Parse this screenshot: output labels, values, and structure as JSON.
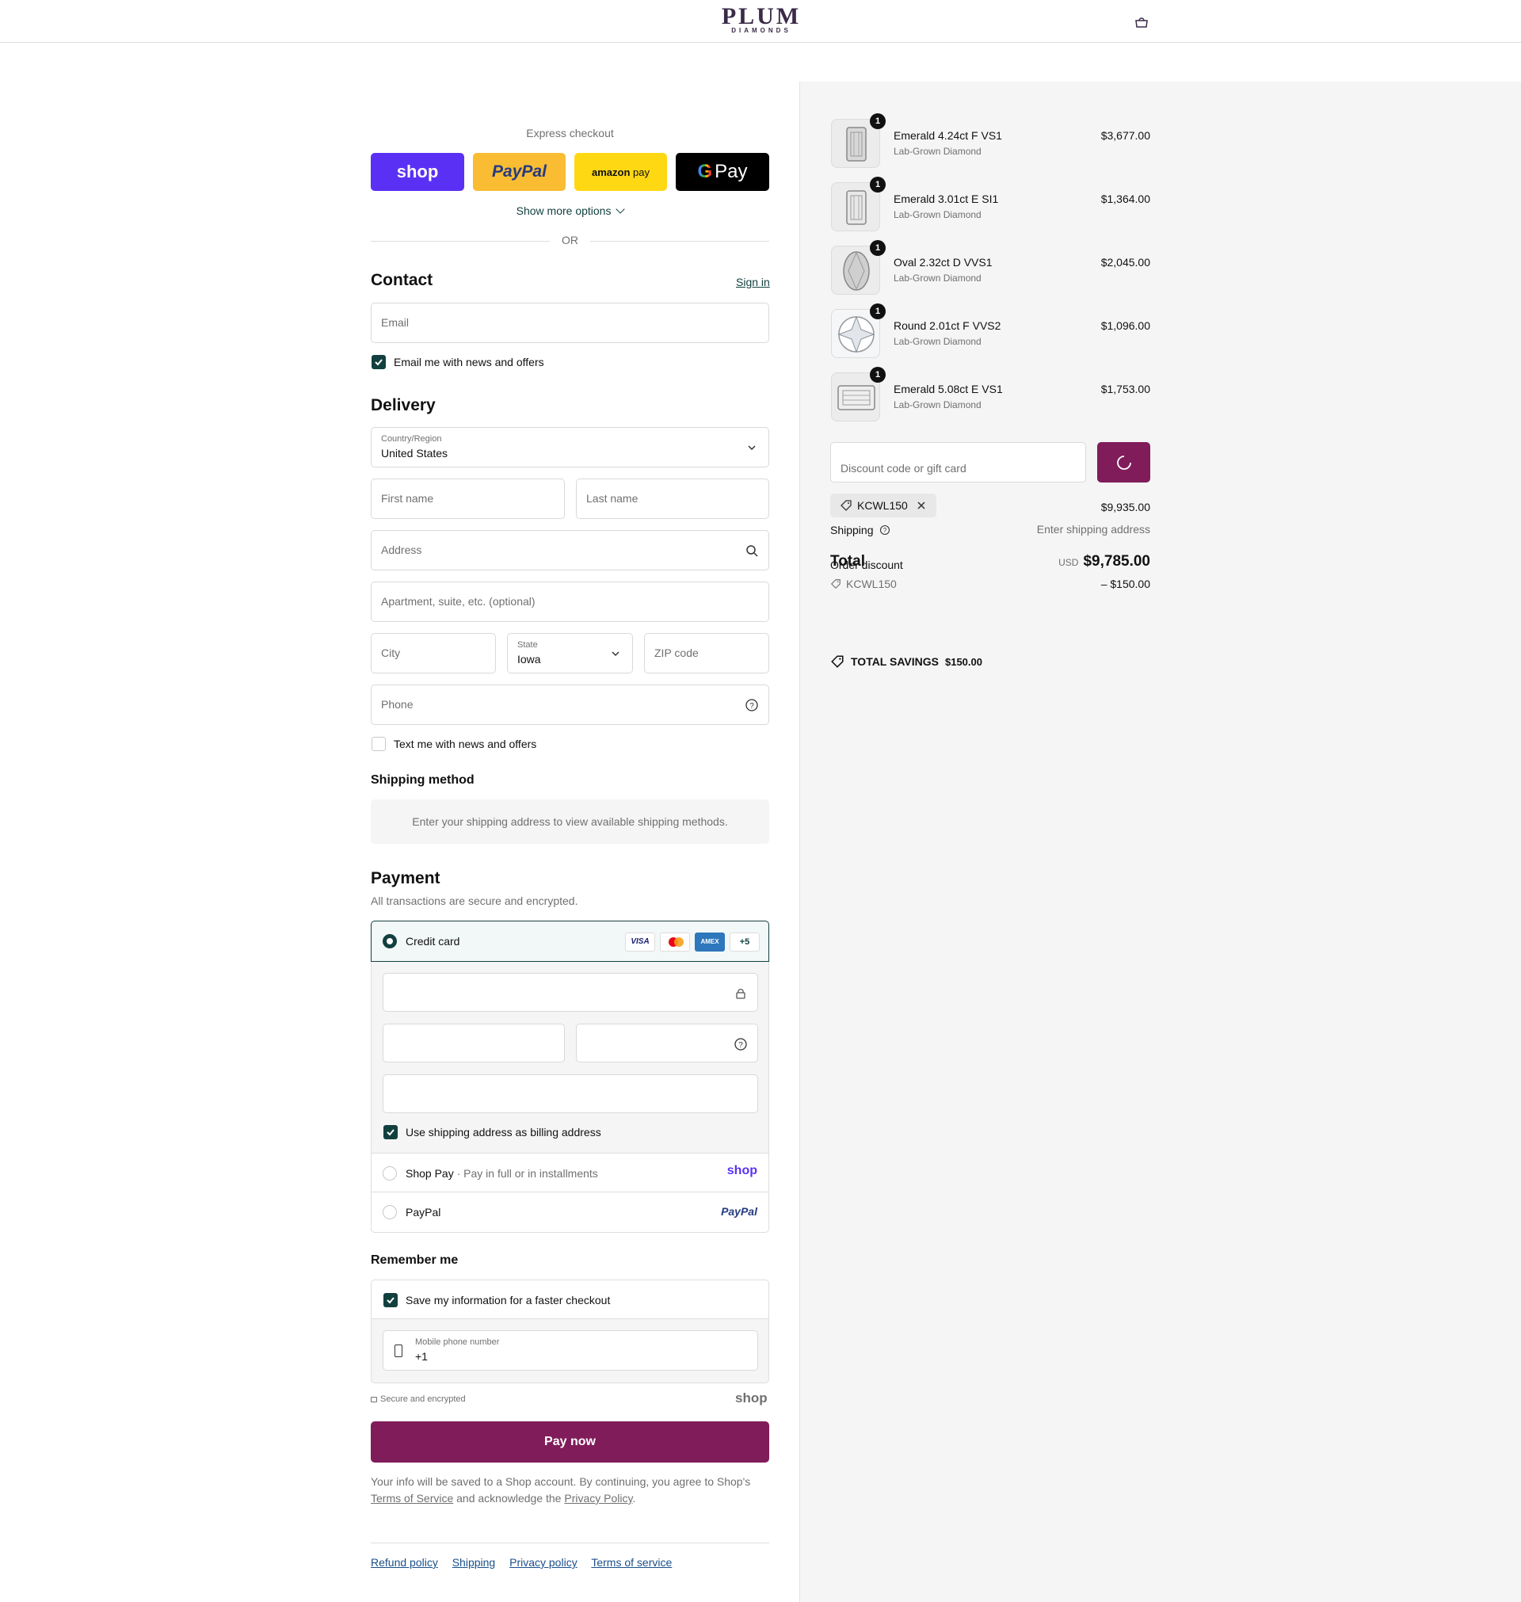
{
  "header": {
    "logo_main": "PLUM",
    "logo_sub": "DIAMONDS",
    "cart_icon": "shopping-bag-icon"
  },
  "express": {
    "title": "Express checkout",
    "buttons": {
      "shop": "shop",
      "paypal": "PayPal",
      "amazon": "amazon",
      "amazon_pay": "pay",
      "gpay": "Pay"
    },
    "more": "Show more options",
    "or": "OR"
  },
  "contact": {
    "title": "Contact",
    "sign_in": "Sign in",
    "email_placeholder": "Email",
    "news_label": "Email me with news and offers",
    "news_checked": true
  },
  "delivery": {
    "title": "Delivery",
    "country_label": "Country/Region",
    "country_value": "United States",
    "first_name": "First name",
    "last_name": "Last name",
    "address": "Address",
    "apartment": "Apartment, suite, etc. (optional)",
    "city": "City",
    "state_label": "State",
    "state_value": "Iowa",
    "zip": "ZIP code",
    "phone": "Phone",
    "text_label": "Text me with news and offers",
    "text_checked": false
  },
  "shipping_method": {
    "title": "Shipping method",
    "message": "Enter your shipping address to view available shipping methods."
  },
  "payment": {
    "title": "Payment",
    "subtitle": "All transactions are secure and encrypted.",
    "credit_card": "Credit card",
    "card_logos": {
      "visa": "VISA",
      "amex": "AMEX",
      "more": "+5"
    },
    "billing_label": "Use shipping address as billing address",
    "shop_pay": "Shop Pay",
    "shop_pay_dot": "·",
    "shop_pay_sub": "Pay in full or in installments",
    "shop_logo": "shop",
    "paypal": "PayPal",
    "paypal_logo": "PayPal"
  },
  "remember": {
    "title": "Remember me",
    "save_label": "Save my information for a faster checkout",
    "mobile_label": "Mobile phone number",
    "mobile_value": "+1",
    "secure": "Secure and encrypted",
    "shop_logo": "shop"
  },
  "pay_now": "Pay now",
  "legal": {
    "part1": "Your info will be saved to a Shop account. By continuing, you agree to Shop's",
    "tos": "Terms of Service",
    "part2": "and acknowledge the",
    "privacy": "Privacy Policy",
    "part3": "."
  },
  "footer_links": [
    "Refund policy",
    "Shipping",
    "Privacy policy",
    "Terms of service"
  ],
  "summary": {
    "items": [
      {
        "qty": "1",
        "name": "Emerald 4.24ct F VS1",
        "sub": "Lab-Grown Diamond",
        "price": "$3,677.00",
        "shape": "emerald"
      },
      {
        "qty": "1",
        "name": "Emerald 3.01ct E SI1",
        "sub": "Lab-Grown Diamond",
        "price": "$1,364.00",
        "shape": "emerald"
      },
      {
        "qty": "1",
        "name": "Oval 2.32ct D VVS1",
        "sub": "Lab-Grown Diamond",
        "price": "$2,045.00",
        "shape": "oval"
      },
      {
        "qty": "1",
        "name": "Round 2.01ct F VVS2",
        "sub": "Lab-Grown Diamond",
        "price": "$1,096.00",
        "shape": "round"
      },
      {
        "qty": "1",
        "name": "Emerald 5.08ct E VS1",
        "sub": "Lab-Grown Diamond",
        "price": "$1,753.00",
        "shape": "emerald-flat"
      }
    ],
    "discount_placeholder": "Discount code or gift card",
    "code_chip": "KCWL150",
    "subtotal_value": "$9,935.00",
    "shipping_label": "Shipping",
    "shipping_value": "Enter shipping address",
    "total_label": "Total",
    "order_discount_label": "Order discount",
    "total_currency": "USD",
    "total_value": "$9,785.00",
    "discount_code": "KCWL150",
    "discount_value": "– $150.00",
    "savings_label": "TOTAL SAVINGS",
    "savings_value": "$150.00"
  },
  "colors": {
    "accent": "#801c5a",
    "brand_dark": "#12403f",
    "shop_purple": "#5a31f4",
    "paypal_yellow": "#f9bc33",
    "amazon_yellow": "#ffd814"
  }
}
